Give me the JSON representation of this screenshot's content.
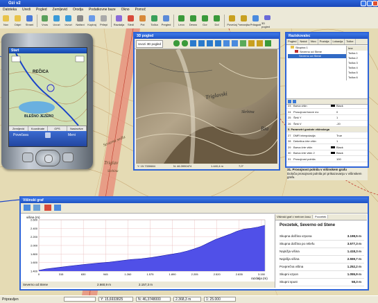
{
  "app": {
    "title": "Ozi v2"
  },
  "menu": [
    "Datoteka",
    "Uredi",
    "Pogled",
    "Zemljevid",
    "Orodja",
    "Podatkovne baze",
    "Okno",
    "Pomoč"
  ],
  "toolbar": [
    "Nov",
    "Odpri",
    "Shrani",
    "Vnos",
    "Uvozi",
    "Izvozi",
    "Natisni",
    "Kopiraj",
    "Prilepi",
    "Razdalja",
    "Sledi",
    "Pot",
    "Točka",
    "Pregled",
    "Levo",
    "Desno",
    "Gor",
    "Dol",
    "Povečaj",
    "Pomanjšaj",
    "Prilagodi",
    "3D pogled"
  ],
  "map": {
    "labels": [
      "Sevarna sedla",
      "Triglav",
      "Skrbina",
      "Slavski podi",
      "Triglavski"
    ]
  },
  "pda": {
    "title": "Start",
    "lake": "BLEŠNO JEZERO",
    "place": "REČICA",
    "tabs": [
      "Zemljevid",
      "Koordinate",
      "GPS",
      "Nastavitve"
    ],
    "soft_left": "Povečava",
    "soft_right": "Meni"
  },
  "view3d": {
    "title": "3D pogled",
    "toolbar_label": "Uvozi 3D pogled",
    "labels": [
      "Triglavski",
      "Skrbina",
      "Ria"
    ],
    "status": [
      "Y: 15.7330684",
      "N: 46.3990474",
      "1.440,4 m",
      "7,0°"
    ]
  },
  "rpanel": {
    "title": "Raziskovalec",
    "tabs": [
      "Pogled",
      "Nalož",
      "Nivo",
      "Pozicija",
      "Lokacija",
      "Točke"
    ],
    "tree": [
      "Skupina 1",
      "Severno od Stene",
      "Severno od Stene"
    ],
    "list": [
      "Ime",
      "Točka 1",
      "Točka 2",
      "Točka 3",
      "Točka 4",
      "Točka 5",
      "Točka 6"
    ],
    "rows": [
      {
        "n": "23",
        "k": "Barva višin",
        "v": "Black"
      },
      {
        "n": "24",
        "k": "Prosojnost barve mc",
        "v": "0"
      },
      {
        "n": "25",
        "k": "Širši Y",
        "v": "1"
      },
      {
        "n": "26",
        "k": "Širši V",
        "v": "-20"
      },
      {
        "n": "",
        "k": "5. Parametri gostote višinskega",
        "v": ""
      },
      {
        "n": "27",
        "k": "DMR interpolacija",
        "v": "True"
      },
      {
        "n": "28",
        "k": "Debelina črte višin",
        "v": "1"
      },
      {
        "n": "29",
        "k": "Barva črte višin",
        "v": "Black"
      },
      {
        "n": "30",
        "k": "Barva črte višin 2",
        "v": "Black"
      },
      {
        "n": "31",
        "k": "Prosojnost polnila",
        "v": "100"
      }
    ],
    "desc_title": "31. Prosojnost polnila v višinskem grafu",
    "desc": "Določa prosojnost polnila pri prikazovanju v višinskem grafu."
  },
  "graph": {
    "title": "Višinski graf",
    "footer": [
      "Severno od Stene",
      "2.660,9 m",
      "2.157,3 m"
    ],
    "info_tabs": [
      "Višinski graf v metrom času",
      "Povzetek"
    ],
    "info_title": "Povzetek, Severno od Stene",
    "info_rows": [
      {
        "k": "Skupna dolžina vzpona",
        "v": "3.198,5 m"
      },
      {
        "k": "Skupna dolžina po reliefu",
        "v": "3.577,3 m"
      },
      {
        "k": "Najnižja višina",
        "v": "1.418,3 m"
      },
      {
        "k": "Najvišja višina",
        "v": "2.559,7 m"
      },
      {
        "k": "Povprečna višina",
        "v": "1.252,2 m"
      },
      {
        "k": "Skupni vzpon",
        "v": "1.055,9 m"
      },
      {
        "k": "Skupni spust",
        "v": "58,3 m"
      }
    ]
  },
  "chart_data": {
    "type": "area",
    "ylabel": "višina (m)",
    "xlabel": "razdalja (m)",
    "x_ticks": [
      "0",
      "315",
      "630",
      "945",
      "1.260",
      "1.575",
      "1.890",
      "2.205",
      "2.520",
      "2.835",
      "3.150"
    ],
    "y_ticks": [
      "1.400",
      "1.600",
      "1.800",
      "2.000",
      "2.200",
      "2.400",
      "2.600"
    ],
    "xlim": [
      0,
      3200
    ],
    "ylim": [
      1400,
      2600
    ],
    "x": [
      0,
      100,
      250,
      400,
      550,
      700,
      850,
      1000,
      1150,
      1300,
      1450,
      1600,
      1750,
      1900,
      2000,
      2100,
      2200,
      2300,
      2400,
      2500,
      2600,
      2700,
      2800,
      2900,
      3000,
      3100,
      3198
    ],
    "y": [
      1418,
      1450,
      1480,
      1510,
      1540,
      1565,
      1590,
      1610,
      1640,
      1670,
      1690,
      1720,
      1760,
      1800,
      1830,
      1870,
      1920,
      1980,
      2060,
      2140,
      2200,
      2260,
      2330,
      2380,
      2400,
      2430,
      2470
    ]
  },
  "status": {
    "label": "Pripravljen",
    "coords": [
      "Y: 15,6933825",
      "N: 46,3748000"
    ],
    "elev": "2.368,3 m",
    "zoom": "1: 25.000"
  },
  "colors": {
    "title": "#245edc",
    "graph_fill": "#5050e8",
    "ridge": "#d86a5a"
  }
}
